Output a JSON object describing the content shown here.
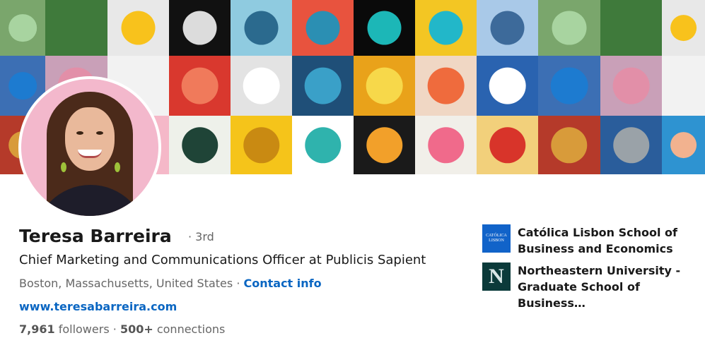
{
  "profile": {
    "name": "Teresa Barreira",
    "degree": "· 3rd",
    "headline": "Chief Marketing and Communications Officer at Publicis Sapient",
    "location": "Boston, Massachusetts, United States",
    "separator": "·",
    "contact_label": "Contact info",
    "website": "www.teresabarreira.com",
    "followers_count": "7,961",
    "followers_label": "followers",
    "connections_sep": "·",
    "connections_count": "500+",
    "connections_label": "connections"
  },
  "education": [
    {
      "name": "Católica Lisbon School of Business and Economics",
      "logo_text": "CATÓLICA LISBON"
    },
    {
      "name": "Northeastern University - Graduate School of Business…",
      "logo_text": "N"
    }
  ],
  "colors": {
    "link": "#0a66c2",
    "text_primary": "#191919",
    "text_secondary": "#666666",
    "avatar_bg": "#f3b8cc"
  }
}
